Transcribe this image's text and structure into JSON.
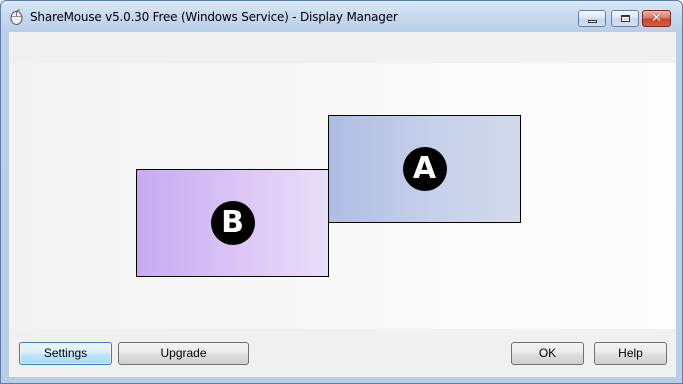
{
  "window": {
    "title": "ShareMouse v5.0.30 Free (Windows Service) - Display Manager",
    "app_icon": "mouse-icon",
    "caption_buttons": {
      "minimize_icon": "minimize-icon",
      "maximize_icon": "maximize-icon",
      "close_icon": "close-icon",
      "close_glyph": "✕"
    }
  },
  "monitors": [
    {
      "id": "A",
      "label": "A",
      "color": "#c2cdeb"
    },
    {
      "id": "B",
      "label": "B",
      "color": "#d6bff5"
    }
  ],
  "buttons": {
    "settings": "Settings",
    "upgrade": "Upgrade",
    "ok": "OK",
    "help": "Help"
  },
  "colors": {
    "frame": "#b9cfe9",
    "client": "#f0f0f0",
    "close_button": "#c8452c",
    "focused_button_border": "#3c7fb1"
  }
}
